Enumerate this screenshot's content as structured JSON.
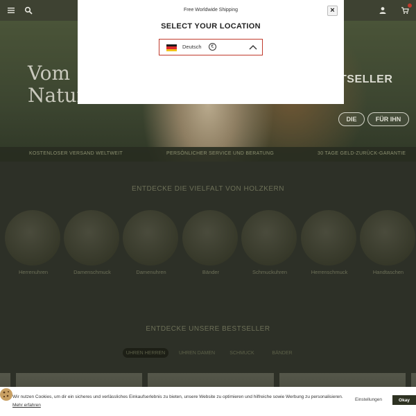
{
  "header": {
    "menu_icon": "hamburger-icon",
    "search_icon": "search-icon",
    "account_icon": "user-icon",
    "cart_icon": "cart-icon",
    "cart_badge_color": "#c0392b"
  },
  "hero": {
    "title_line1": "Vom",
    "title_line2": "Natur",
    "subtitle": "TSELLER",
    "buttons": [
      "DIE",
      "FÜR IHN"
    ]
  },
  "usp_bar": [
    "KOSTENLOSER VERSAND WELTWEIT",
    "PERSÖNLICHER SERVICE UND BERATUNG",
    "30 TAGE GELD-ZURÜCK-GARANTIE"
  ],
  "categories_section": {
    "title": "ENTDECKE DIE VIELFALT VON HOLZKERN",
    "items": [
      "Herrenuhren",
      "Damenschmuck",
      "Damenuhren",
      "Bänder",
      "Schmuckuhren",
      "Herrenschmuck",
      "Handtaschen"
    ]
  },
  "bestseller_section": {
    "title": "ENTDECKE UNSERE BESTSELLER",
    "tabs": [
      "UHREN HERREN",
      "UHREN DAMEN",
      "SCHMUCK",
      "BÄNDER"
    ],
    "active_tab": 0
  },
  "location_modal": {
    "shipping_note": "Free Worldwide Shipping",
    "title": "SELECT YOUR LOCATION",
    "selected_language": "Deutsch",
    "currency_symbol": "€",
    "flag_icon": "germany-flag-icon",
    "accent_color": "#c0392b",
    "close_symbol": "×"
  },
  "cookie_bar": {
    "text": "Wir nutzen Cookies, um dir ein sicheres und verlässliches Einkaufserlebnis zu bieten, unsere Website zu optimieren und hilfreiche sowie Werbung zu personalisieren.",
    "link": "Mehr erfahren",
    "settings_label": "Einstellungen",
    "ok_label": "Okay",
    "icon": "cookie-icon"
  }
}
